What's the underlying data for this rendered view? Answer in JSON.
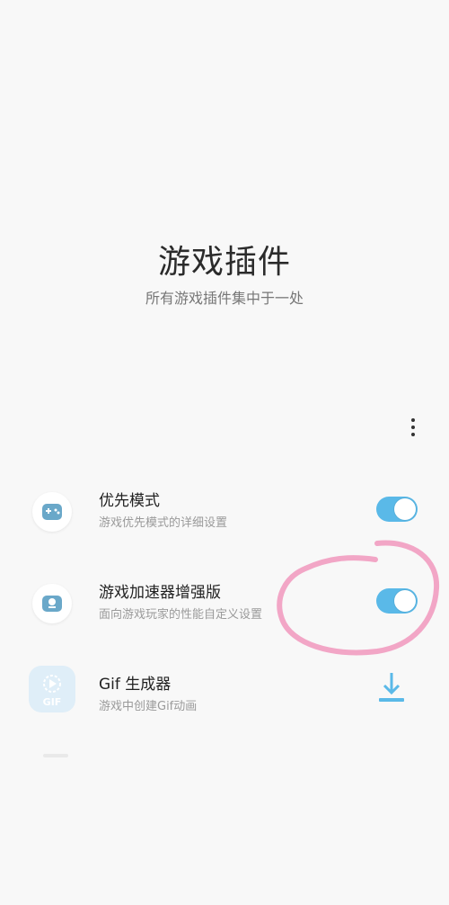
{
  "header": {
    "title": "游戏插件",
    "subtitle": "所有游戏插件集中于一处"
  },
  "menu": {
    "icon": "more-vertical-icon"
  },
  "plugins": [
    {
      "title": "优先模式",
      "description": "游戏优先模式的详细设置",
      "icon": "gamepad-icon",
      "toggle_on": true
    },
    {
      "title": "游戏加速器增强版",
      "description": "面向游戏玩家的性能自定义设置",
      "icon": "game-booster-icon",
      "toggle_on": true
    },
    {
      "title": "Gif 生成器",
      "description": "游戏中创建Gif动画",
      "icon": "gif-icon",
      "icon_text": "GIF",
      "action_icon": "download-icon"
    }
  ],
  "colors": {
    "accent": "#5ab9e8",
    "icon_blue": "#6aa8c9",
    "annotation": "#f2a6c6"
  }
}
